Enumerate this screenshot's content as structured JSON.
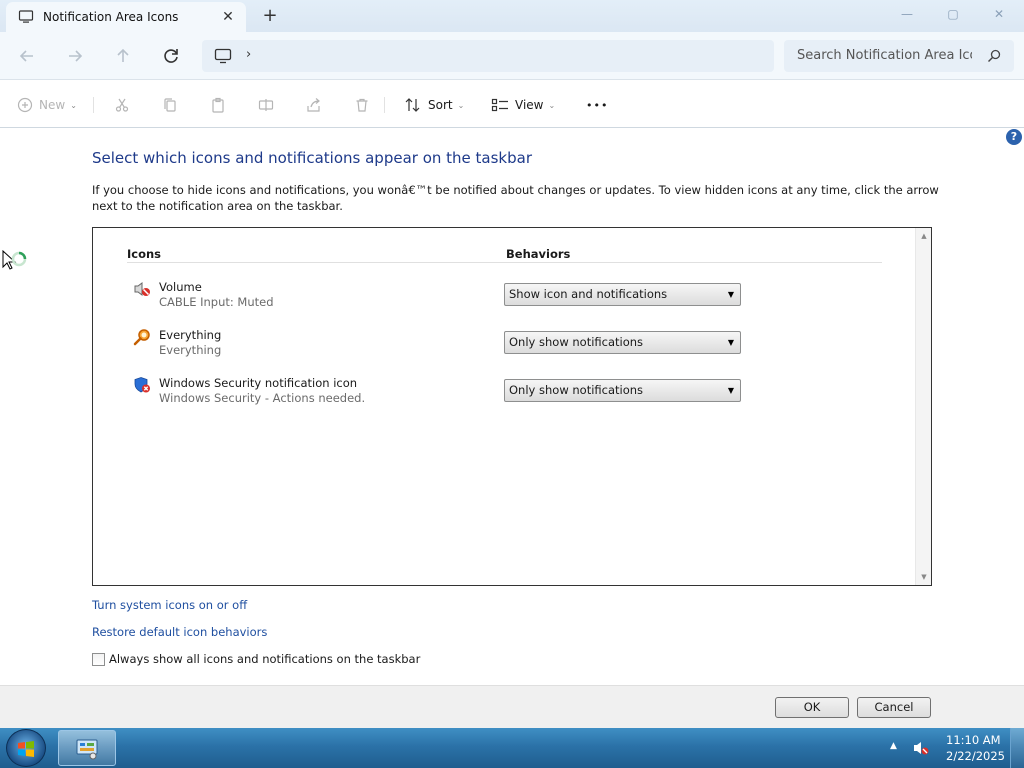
{
  "window": {
    "tab_title": "Notification Area Icons",
    "new_tab": "+",
    "close_tab": "✕",
    "controls": {
      "minimize": "—",
      "maximize": "▢",
      "close": "✕"
    }
  },
  "address": {
    "chevron": "›",
    "search_placeholder": "Search Notification Area Icons"
  },
  "commandbar": {
    "new_label": "New",
    "sort_label": "Sort",
    "view_label": "View",
    "more": "•••",
    "dropdown": "⌄"
  },
  "page": {
    "help": "?",
    "heading": "Select which icons and notifications appear on the taskbar",
    "description": "If you choose to hide icons and notifications, you wonâ€™t be notified about changes or updates. To view hidden icons at any time, click the arrow next to the notification area on the taskbar."
  },
  "list": {
    "col_icons": "Icons",
    "col_behaviors": "Behaviors",
    "rows": [
      {
        "name": "Volume",
        "subtitle": "CABLE Input: Muted",
        "behavior": "Show icon and notifications",
        "icon": "speaker-muted-icon"
      },
      {
        "name": "Everything",
        "subtitle": "Everything",
        "behavior": "Only show notifications",
        "icon": "magnifier-icon"
      },
      {
        "name": "Windows Security notification icon",
        "subtitle": "Windows Security - Actions needed.",
        "behavior": "Only show notifications",
        "icon": "security-shield-icon"
      }
    ],
    "scroll_up": "▲",
    "scroll_down": "▼",
    "select_arrow": "▼"
  },
  "links": {
    "system_icons": "Turn system icons on or off",
    "restore_defaults": "Restore default icon behaviors"
  },
  "checkbox": {
    "label": "Always show all icons and notifications on the taskbar",
    "checked": false
  },
  "buttons": {
    "ok": "OK",
    "cancel": "Cancel"
  },
  "taskbar": {
    "tray_arrow": "▲",
    "time": "11:10 AM",
    "date": "2/22/2025"
  },
  "colors": {
    "heading": "#1e3a8a",
    "link": "#1f4fa0",
    "taskbar": "#2b72a8"
  }
}
